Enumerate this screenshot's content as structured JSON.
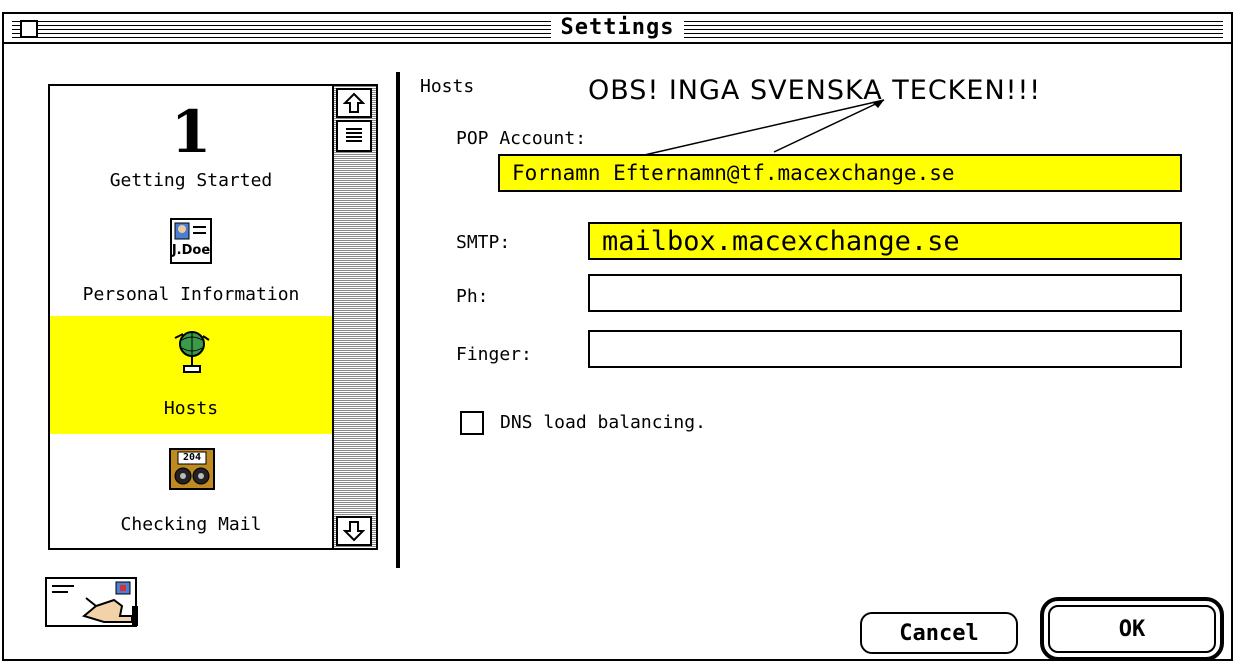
{
  "window": {
    "title": "Settings"
  },
  "sidebar": {
    "items": [
      {
        "label": "Getting Started",
        "icon": "number-one-icon"
      },
      {
        "label": "Personal Information",
        "icon": "id-card-icon",
        "card_text": "J.Doe"
      },
      {
        "label": "Hosts",
        "icon": "globe-network-icon",
        "selected": true
      },
      {
        "label": "Checking Mail",
        "icon": "mail-counter-icon",
        "counter": "204"
      }
    ],
    "big_number": "1"
  },
  "panel": {
    "heading": "Hosts",
    "annotation": "OBS! INGA SVENSKA TECKEN!!!",
    "pop_label": "POP Account:",
    "pop_value": "Fornamn Efternamn@tf.macexchange.se",
    "smtp_label": "SMTP:",
    "smtp_value": "mailbox.macexchange.se",
    "ph_label": "Ph:",
    "ph_value": "",
    "finger_label": "Finger:",
    "finger_value": "",
    "dns_label": "DNS load balancing.",
    "dns_checked": false
  },
  "buttons": {
    "cancel": "Cancel",
    "ok": "OK"
  },
  "colors": {
    "highlight": "#ffff00",
    "icon_gold": "#c08a20",
    "icon_blue": "#4a7fd4"
  }
}
